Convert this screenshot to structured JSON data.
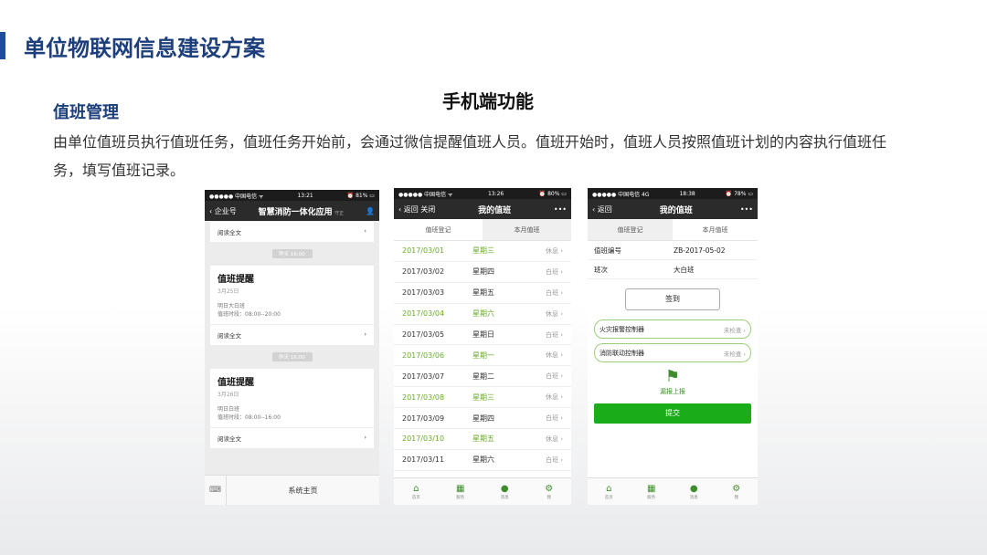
{
  "slide": {
    "title": "单位物联网信息建设方案",
    "subheading": "手机端功能",
    "section": "值班管理",
    "description": "由单位值班员执行值班任务，值班任务开始前，会通过微信提醒值班人员。值班开始时，值班人员按照值班计划的内容执行值班任务，填写值班记录。"
  },
  "phone1": {
    "status": {
      "carrier": "●●●●● 中国电信 ᯤ",
      "time": "13:21",
      "battery": "⏰ 81% ▭"
    },
    "nav": {
      "back": "‹ 企业号",
      "title": "智慧消防一体化应用",
      "sub": "守正",
      "user": "👤"
    },
    "read_more": "阅读全文",
    "time1": "昨天 16:00",
    "card1": {
      "title": "值班提醒",
      "date": "3月25日",
      "line1": "明日大白班",
      "line2": "值班时段：08:00--20:00"
    },
    "time2": "昨天 16:00",
    "card2": {
      "title": "值班提醒",
      "date": "3月26日",
      "line1": "明日白班",
      "line2": "值班时段：08:00--16:00"
    },
    "bottom": "系统主页",
    "chevron": "›"
  },
  "phone2": {
    "status": {
      "carrier": "●●●●● 中国电信 ᯤ",
      "time": "13:26",
      "battery": "⏰ 80% ▭"
    },
    "nav": {
      "back": "‹ 返回  关闭",
      "title": "我的值班",
      "more": "•••"
    },
    "tabs": [
      "值班登记",
      "本月值班"
    ],
    "rows": [
      {
        "date": "2017/03/01",
        "weekday": "星期三",
        "shift": "休息 ›"
      },
      {
        "date": "2017/03/02",
        "weekday": "星期四",
        "shift": "白班 ›"
      },
      {
        "date": "2017/03/03",
        "weekday": "星期五",
        "shift": "白班 ›"
      },
      {
        "date": "2017/03/04",
        "weekday": "星期六",
        "shift": "休息 ›"
      },
      {
        "date": "2017/03/05",
        "weekday": "星期日",
        "shift": "白班 ›"
      },
      {
        "date": "2017/03/06",
        "weekday": "星期一",
        "shift": "休息 ›"
      },
      {
        "date": "2017/03/07",
        "weekday": "星期二",
        "shift": "白班 ›"
      },
      {
        "date": "2017/03/08",
        "weekday": "星期三",
        "shift": "休息 ›"
      },
      {
        "date": "2017/03/09",
        "weekday": "星期四",
        "shift": "白班 ›"
      },
      {
        "date": "2017/03/10",
        "weekday": "星期五",
        "shift": "休息 ›"
      },
      {
        "date": "2017/03/11",
        "weekday": "星期六",
        "shift": "白班 ›"
      }
    ],
    "tabbar": [
      {
        "icon": "⌂",
        "label": "首页"
      },
      {
        "icon": "▦",
        "label": "服务"
      },
      {
        "icon": "●",
        "label": "消息"
      },
      {
        "icon": "⚙",
        "label": "我"
      }
    ]
  },
  "phone3": {
    "status": {
      "carrier": "●●●●● 中国电信 4G",
      "time": "18:38",
      "battery": "⏰ 78% ▭"
    },
    "nav": {
      "back": "‹ 返回",
      "title": "我的值班",
      "more": "•••"
    },
    "tabs": [
      "值班登记",
      "本月值班"
    ],
    "duty_no_label": "值班编号",
    "duty_no": "ZB-2017-05-02",
    "shift_label": "班次",
    "shift": "大白班",
    "sign_in": "签到",
    "controllers": [
      {
        "name": "火灾报警控制器",
        "status": "未检查 ›"
      },
      {
        "name": "消防联动控制器",
        "status": "未检查 ›"
      }
    ],
    "report_icon": "⚑",
    "report": "漏报上报",
    "submit": "提交",
    "tabbar": [
      {
        "icon": "⌂",
        "label": "首页"
      },
      {
        "icon": "▦",
        "label": "服务"
      },
      {
        "icon": "●",
        "label": "消息"
      },
      {
        "icon": "⚙",
        "label": "我"
      }
    ]
  }
}
